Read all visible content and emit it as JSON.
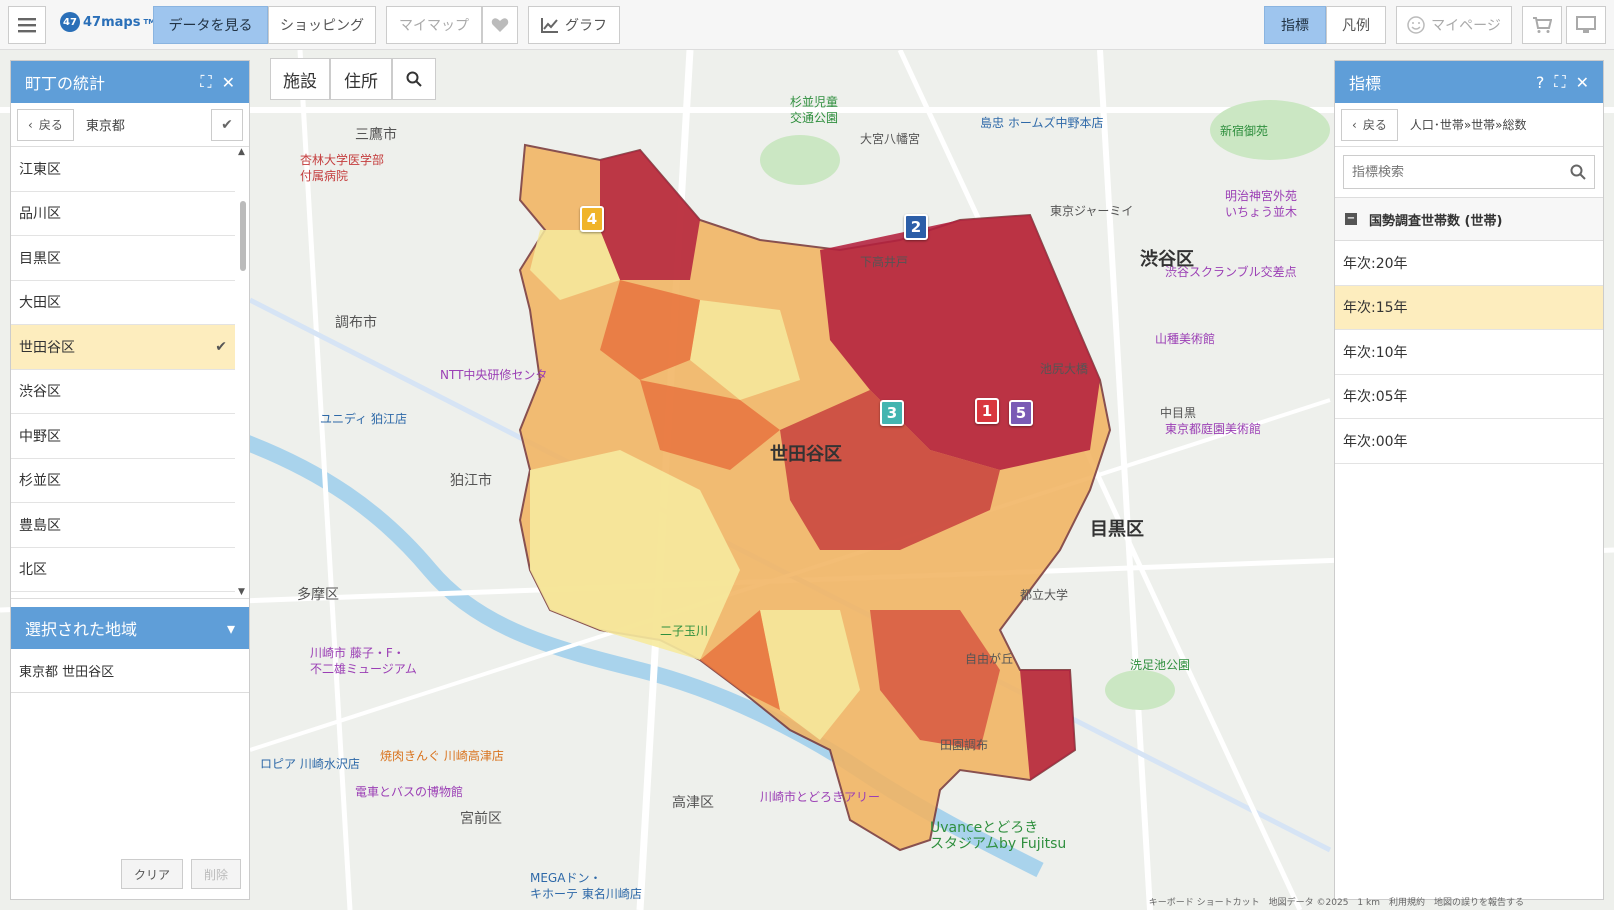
{
  "topbar": {
    "logo_badge": "47",
    "logo_text": "47maps",
    "logo_tm": "TM",
    "tab_data": "データを見る",
    "tab_shopping": "ショッピング",
    "mymap": "マイマップ",
    "graph": "グラフ",
    "indicator": "指標",
    "legend": "凡例",
    "mypage": "マイページ"
  },
  "map_search": {
    "facility": "施設",
    "address": "住所"
  },
  "left_panel": {
    "title": "町丁の統計",
    "back": "戻る",
    "breadcrumb": "東京都",
    "items": [
      {
        "label": "江東区",
        "selected": false
      },
      {
        "label": "品川区",
        "selected": false
      },
      {
        "label": "目黒区",
        "selected": false
      },
      {
        "label": "大田区",
        "selected": false
      },
      {
        "label": "世田谷区",
        "selected": true
      },
      {
        "label": "渋谷区",
        "selected": false
      },
      {
        "label": "中野区",
        "selected": false
      },
      {
        "label": "杉並区",
        "selected": false
      },
      {
        "label": "豊島区",
        "selected": false
      },
      {
        "label": "北区",
        "selected": false
      }
    ],
    "selected_title": "選択された地域",
    "selected_region": "東京都 世田谷区",
    "clear": "クリア",
    "delete": "削除"
  },
  "right_panel": {
    "title": "指標",
    "back": "戻る",
    "breadcrumb": "人口･世帯»世帯»総数",
    "search_placeholder": "指標検索",
    "group": "国勢調査世帯数 (世帯)",
    "items": [
      {
        "label": "年次:20年",
        "selected": false
      },
      {
        "label": "年次:15年",
        "selected": true
      },
      {
        "label": "年次:10年",
        "selected": false
      },
      {
        "label": "年次:05年",
        "selected": false
      },
      {
        "label": "年次:00年",
        "selected": false
      }
    ]
  },
  "map": {
    "labels": {
      "setagaya": "世田谷区",
      "shibuya": "渋谷区",
      "meguro": "目黒区",
      "mitaka": "三鷹市",
      "chofu": "調布市",
      "komae": "狛江市",
      "tama": "多摩区",
      "miyamae": "宮前区",
      "takatsu": "高津区",
      "kyorin": "杏林大学医学部\n付属病院",
      "shimotakaido": "下高井戸",
      "ntt": "NTT中央研修センタ",
      "unidy": "ユニディ 狛江店",
      "todoroki": "川崎市とどろきアリー",
      "uvance": "Uvanceとどろき\nスタジアムby Fujitsu",
      "fujiko": "川崎市 藤子・F・\n不二雄ミュージアム",
      "denshabus": "電車とバスの博物館",
      "yakiniku": "焼肉きんぐ 川崎高津店",
      "rapia": "ロピア 川崎水沢店",
      "mega": "MEGAドン・\nキホーテ 東名川崎店",
      "shimaChu": "島忠 ホームズ中野本店",
      "tokyoJamii": "東京ジャーミイ",
      "shibuyaScramble": "渋谷スクランブル交差点",
      "meijiJingu": "明治神宮外苑\nいちょう並木",
      "yamatane": "山種美術館",
      "teien": "東京都庭園美術館",
      "senzoku": "洗足池公園",
      "tamagawa": "二子玉川",
      "denenchofu": "田園調布",
      "jiyugaoka": "自由が丘",
      "suginami": "杉並児童\n交通公園",
      "omiya": "大宮八幡宮",
      "shinjukuGyoen": "新宿御苑",
      "ikejiriohashi": "池尻大橋",
      "toritsudaigaku": "都立大学",
      "nakameguro": "中目黒"
    },
    "attribution": "キーボード ショートカット　地図データ ©2025　1 km　利用規約　地図の誤りを報告する"
  }
}
